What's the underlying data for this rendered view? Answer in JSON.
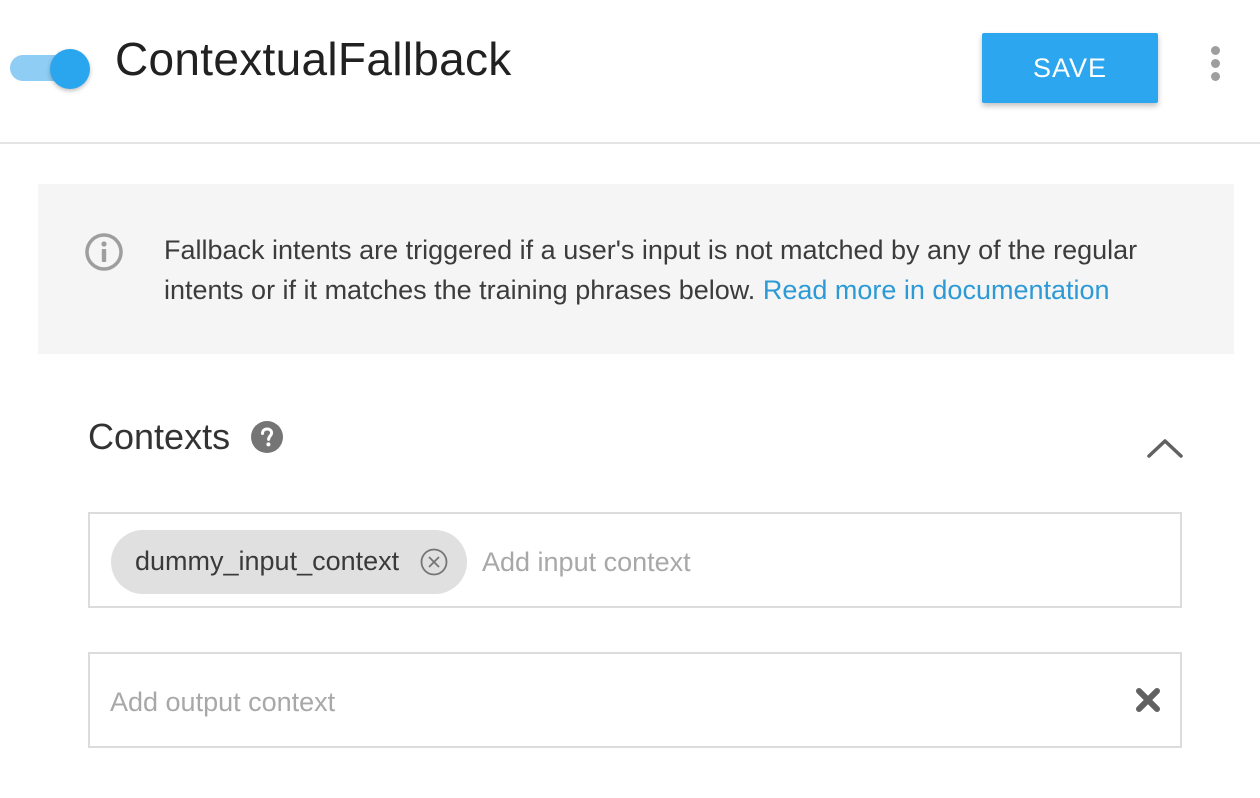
{
  "header": {
    "title": "ContextualFallback",
    "save_label": "SAVE",
    "toggle_state": "on",
    "more_icon": "more-vert-icon",
    "accent_color": "#2ba6ef"
  },
  "info": {
    "icon": "info-icon",
    "text": "Fallback intents are triggered if a user's input is not matched by any of the regular intents or if it matches the training phrases below.",
    "link_text": "Read more in documentation",
    "link_color": "#2d9ad6"
  },
  "contexts": {
    "label": "Contexts",
    "help_icon": "help-icon",
    "collapse_icon": "chevron-up-icon",
    "input": {
      "chips": [
        "dummy_input_context"
      ],
      "placeholder": "Add input context"
    },
    "output": {
      "placeholder": "Add output context",
      "clear_icon": "clear-icon"
    }
  }
}
